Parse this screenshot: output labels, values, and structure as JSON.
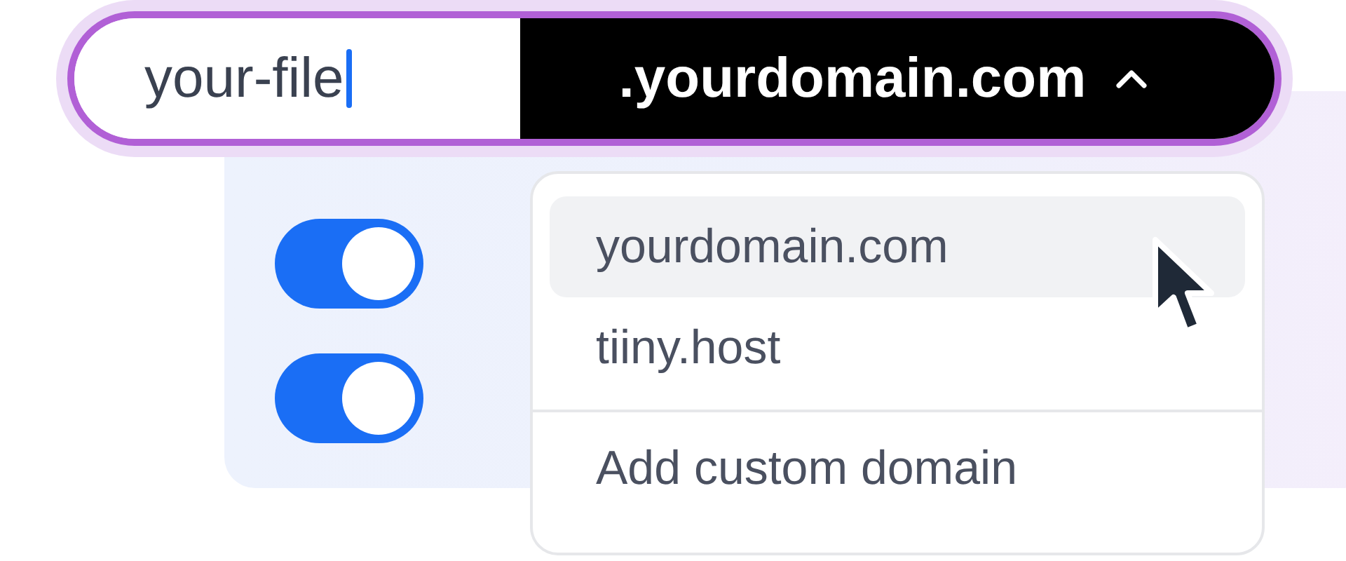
{
  "filename_field": {
    "value": "your-file",
    "focused": true
  },
  "domain_select": {
    "label": ".yourdomain.com",
    "expanded": true
  },
  "toggles": [
    {
      "on": true
    },
    {
      "on": true
    }
  ],
  "dropdown": {
    "items": [
      {
        "label": "yourdomain.com",
        "selected": true
      },
      {
        "label": "tiiny.host",
        "selected": false
      }
    ],
    "footer_item": {
      "label": "Add custom domain"
    }
  }
}
